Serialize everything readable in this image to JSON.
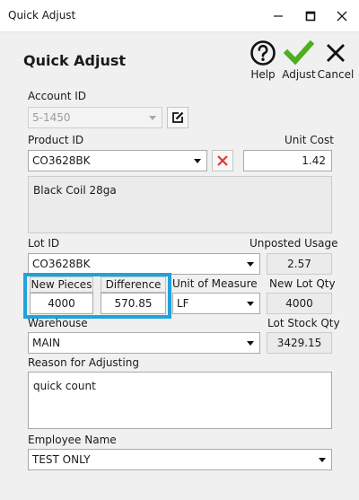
{
  "window": {
    "title": "Quick Adjust"
  },
  "header": {
    "title": "Quick Adjust"
  },
  "toolbar": {
    "help_label": "Help",
    "adjust_label": "Adjust",
    "cancel_label": "Cancel"
  },
  "fields": {
    "account_id": {
      "label": "Account ID",
      "value": "5-1450"
    },
    "product_id": {
      "label": "Product ID",
      "value": "CO3628BK"
    },
    "unit_cost": {
      "label": "Unit Cost",
      "value": "1.42"
    },
    "description": {
      "value": "Black Coil 28ga"
    },
    "lot_id": {
      "label": "Lot ID",
      "value": "CO3628BK"
    },
    "unposted_usage": {
      "label": "Unposted Usage",
      "value": "2.57"
    },
    "new_pieces": {
      "label": "New Pieces",
      "value": "4000"
    },
    "difference": {
      "label": "Difference",
      "value": "570.85"
    },
    "unit_of_measure": {
      "label": "Unit of Measure",
      "value": "LF"
    },
    "new_lot_qty": {
      "label": "New Lot Qty",
      "value": "4000"
    },
    "warehouse": {
      "label": "Warehouse",
      "value": "MAIN"
    },
    "lot_stock_qty": {
      "label": "Lot Stock Qty",
      "value": "3429.15"
    },
    "reason": {
      "label": "Reason for Adjusting",
      "value": "quick count"
    },
    "employee_name": {
      "label": "Employee Name",
      "value": "TEST ONLY"
    }
  },
  "colors": {
    "highlight": "#1fa3dc",
    "adjust_check": "#4caf1e",
    "clear_x": "#e53935"
  }
}
